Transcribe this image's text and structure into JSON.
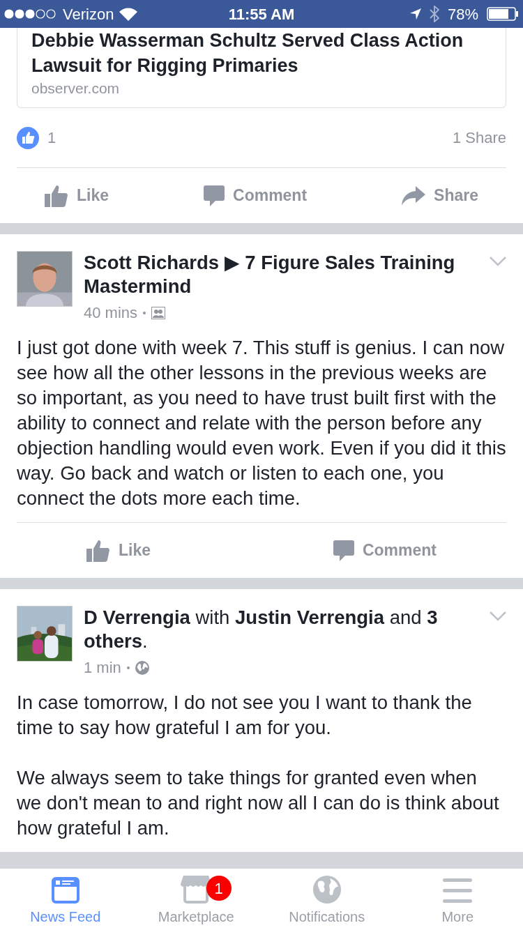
{
  "status_bar": {
    "carrier": "Verizon",
    "time": "11:55 AM",
    "battery": "78%"
  },
  "link_card": {
    "title": "Debbie Wasserman Schultz Served Class Action Lawsuit for Rigging Primaries",
    "domain": "observer.com"
  },
  "link_post_footer": {
    "like_count": "1",
    "shares": "1 Share",
    "actions": [
      {
        "kind": "like",
        "label": "Like"
      },
      {
        "kind": "comment",
        "label": "Comment"
      },
      {
        "kind": "share",
        "label": "Share"
      }
    ]
  },
  "posts": [
    {
      "kind": "group",
      "header": "**Scott Richards** ▶ **7 Figure Sales Training Mastermind**",
      "time": "40 mins",
      "paragraphs": [
        "I just got done with week 7. This stuff is genius. I can now see how all the other lessons in the previous weeks are so important, as you need to have trust built first with the ability to connect and relate with the person before any objection handling would even work. Even if you did it this way. Go back and watch or listen to each one, you connect the dots more each time."
      ],
      "actions": [
        {
          "kind": "like",
          "label": "Like"
        },
        {
          "kind": "comment",
          "label": "Comment"
        }
      ]
    },
    {
      "kind": "public",
      "header": "**D Verrengia** with **Justin Verrengia** and **3 others**.",
      "time": "1 min",
      "paragraphs": [
        "In case tomorrow, I do not see you I want to thank the time to say how grateful I am for you.",
        "We always seem to take things for granted even when we don't mean to and right now all I can do is think about how grateful I am."
      ]
    }
  ],
  "tab_bar": [
    {
      "kind": "feed",
      "label": "News Feed",
      "selected": true
    },
    {
      "kind": "market",
      "label": "Marketplace",
      "selected": false,
      "badge": "1"
    },
    {
      "kind": "globe",
      "label": "Notifications",
      "selected": false
    },
    {
      "kind": "menu",
      "label": "More",
      "selected": false
    }
  ]
}
